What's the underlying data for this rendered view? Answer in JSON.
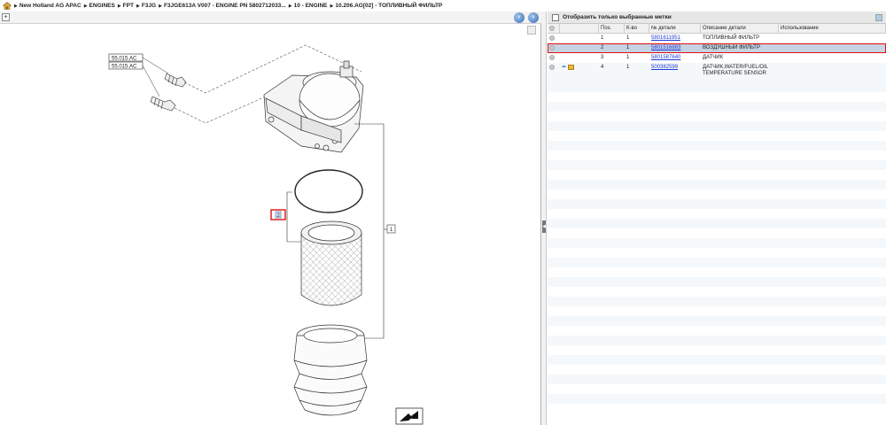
{
  "breadcrumb": [
    "New Holland AG APAC",
    "ENGINES",
    "FPT",
    "F3JG",
    "F3JGE613A V007 - ENGINE PN 5802712033...",
    "10 - ENGINE",
    "10.206.AG[02] - ТОПЛИВНЫЙ ФИЛЬТР"
  ],
  "drawing": {
    "callout_1": "55.015.AC",
    "callout_2": "55.015.AC",
    "item_label_1": "1",
    "item_label_2": "2"
  },
  "filter": {
    "label": "Отобразить только выбранные метки"
  },
  "columns": {
    "pos": "Поз.",
    "qty": "К-во",
    "num": "№ детали",
    "desc": "Описание детали",
    "use": "Использование"
  },
  "parts": [
    {
      "pos": "1",
      "qty": "1",
      "num": "5801611951",
      "desc": "ТОПЛИВНЫЙ ФИЛЬТР",
      "desc2": "",
      "use": ""
    },
    {
      "pos": "2",
      "qty": "1",
      "num": "5801516883",
      "desc": "ВОЗДУШНЫЙ ФИЛЬТР",
      "desc2": "",
      "use": ""
    },
    {
      "pos": "3",
      "qty": "1",
      "num": "5801587640",
      "desc": "ДАТЧИК",
      "desc2": "",
      "use": ""
    },
    {
      "pos": "4",
      "qty": "1",
      "num": "500382599",
      "desc": "ДАТЧИК,WATER/FUEL/OIL",
      "desc2": "TEMPERATURE SENSOR",
      "use": ""
    }
  ],
  "selected_row": 2,
  "colors": {
    "selection_outline": "#e01010",
    "selection_fill": "#c5d3e2",
    "link": "#1f39d6"
  }
}
